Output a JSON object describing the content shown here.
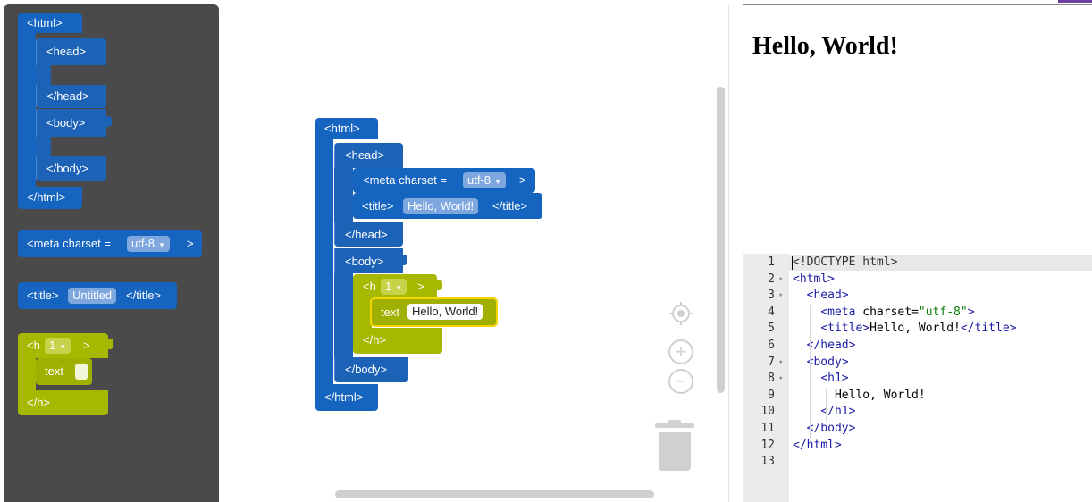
{
  "toolbox": {
    "html_block": {
      "open": "<html>",
      "close": "</html>"
    },
    "head_block": {
      "open": "<head>",
      "close": "</head>"
    },
    "body_block": {
      "open": "<body>",
      "close": "</body>"
    },
    "meta_block": {
      "prefix": "<meta charset =",
      "value": "utf-8",
      "suffix": ">"
    },
    "title_block": {
      "open": "<title>",
      "value": "Untitled",
      "close": "</title>"
    },
    "h_block": {
      "open": "<h",
      "level": "1",
      "gt": ">",
      "text_label": "text",
      "close": "</h>"
    }
  },
  "workspace": {
    "html_open": "<html>",
    "head_open": "<head>",
    "meta": {
      "prefix": "<meta charset =",
      "value": "utf-8",
      "suffix": ">"
    },
    "title": {
      "open": "<title>",
      "value": "Hello, World!",
      "close": "</title>"
    },
    "head_close": "</head>",
    "body_open": "<body>",
    "h": {
      "open": "<h",
      "level": "1",
      "gt": ">",
      "text_label": "text",
      "text_value": "Hello, World!",
      "close": "</h>"
    },
    "body_close": "</body>",
    "html_close": "</html>"
  },
  "controls": {
    "zoom_in": "+",
    "zoom_out": "−"
  },
  "preview": {
    "heading": "Hello, World!"
  },
  "editor": {
    "lines": [
      {
        "n": "1",
        "text": "<!DOCTYPE html>"
      },
      {
        "n": "2",
        "text": "<html>"
      },
      {
        "n": "3",
        "text": "  <head>"
      },
      {
        "n": "4",
        "text": "    <meta charset=\"utf-8\">"
      },
      {
        "n": "5",
        "text": "    <title>Hello, World!</title>"
      },
      {
        "n": "6",
        "text": "  </head>"
      },
      {
        "n": "7",
        "text": "  <body>"
      },
      {
        "n": "8",
        "text": "    <h1>"
      },
      {
        "n": "9",
        "text": "      Hello, World!"
      },
      {
        "n": "10",
        "text": "    </h1>"
      },
      {
        "n": "11",
        "text": "  </body>"
      },
      {
        "n": "12",
        "text": "</html>"
      },
      {
        "n": "13",
        "text": ""
      }
    ],
    "foldable_lines": [
      "2",
      "3",
      "7",
      "8"
    ]
  },
  "colors": {
    "block_blue": "#1565c0",
    "block_olive": "#a6b800",
    "toolbox_bg": "#4a4a4a",
    "accent": "#6b3fa0"
  }
}
